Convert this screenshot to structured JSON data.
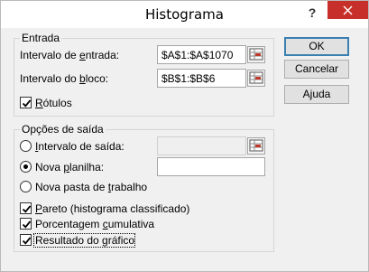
{
  "window": {
    "title": "Histograma",
    "help_glyph": "?"
  },
  "input_section": {
    "title": "Entrada",
    "input_range": {
      "label_pre": "Intervalo de ",
      "label_u": "e",
      "label_post": "ntrada:",
      "value": "$A$1:$A$1070"
    },
    "bin_range": {
      "label_pre": "Intervalo do ",
      "label_u": "b",
      "label_post": "loco:",
      "value": "$B$1:$B$6"
    },
    "labels_checkbox": {
      "label_u": "R",
      "label_post": "ótulos",
      "checked": true
    }
  },
  "output_section": {
    "title": "Opções de saída",
    "output_range": {
      "label_u": "I",
      "label_post": "ntervalo de saída:",
      "selected": false,
      "value": ""
    },
    "new_worksheet": {
      "label_pre": "Nova ",
      "label_u": "p",
      "label_post": "lanilha:",
      "selected": true,
      "value": ""
    },
    "new_workbook": {
      "label_pre": "Nova pasta de ",
      "label_u": "t",
      "label_post": "rabalho",
      "selected": false
    }
  },
  "options": {
    "pareto": {
      "label_u": "P",
      "label_post": "areto (histograma classificado)",
      "checked": true
    },
    "cumulative": {
      "label_pre": "Porcentagem ",
      "label_u": "c",
      "label_post": "umulativa",
      "checked": true
    },
    "chart_output": {
      "label": "Resultado do gráfico",
      "checked": true
    }
  },
  "buttons": {
    "ok": "OK",
    "cancel": "Cancelar",
    "help_pre": "A",
    "help_u": "j",
    "help_post": "uda"
  },
  "icons": {
    "range_picker": "range-selector-icon",
    "close": "close-icon"
  }
}
